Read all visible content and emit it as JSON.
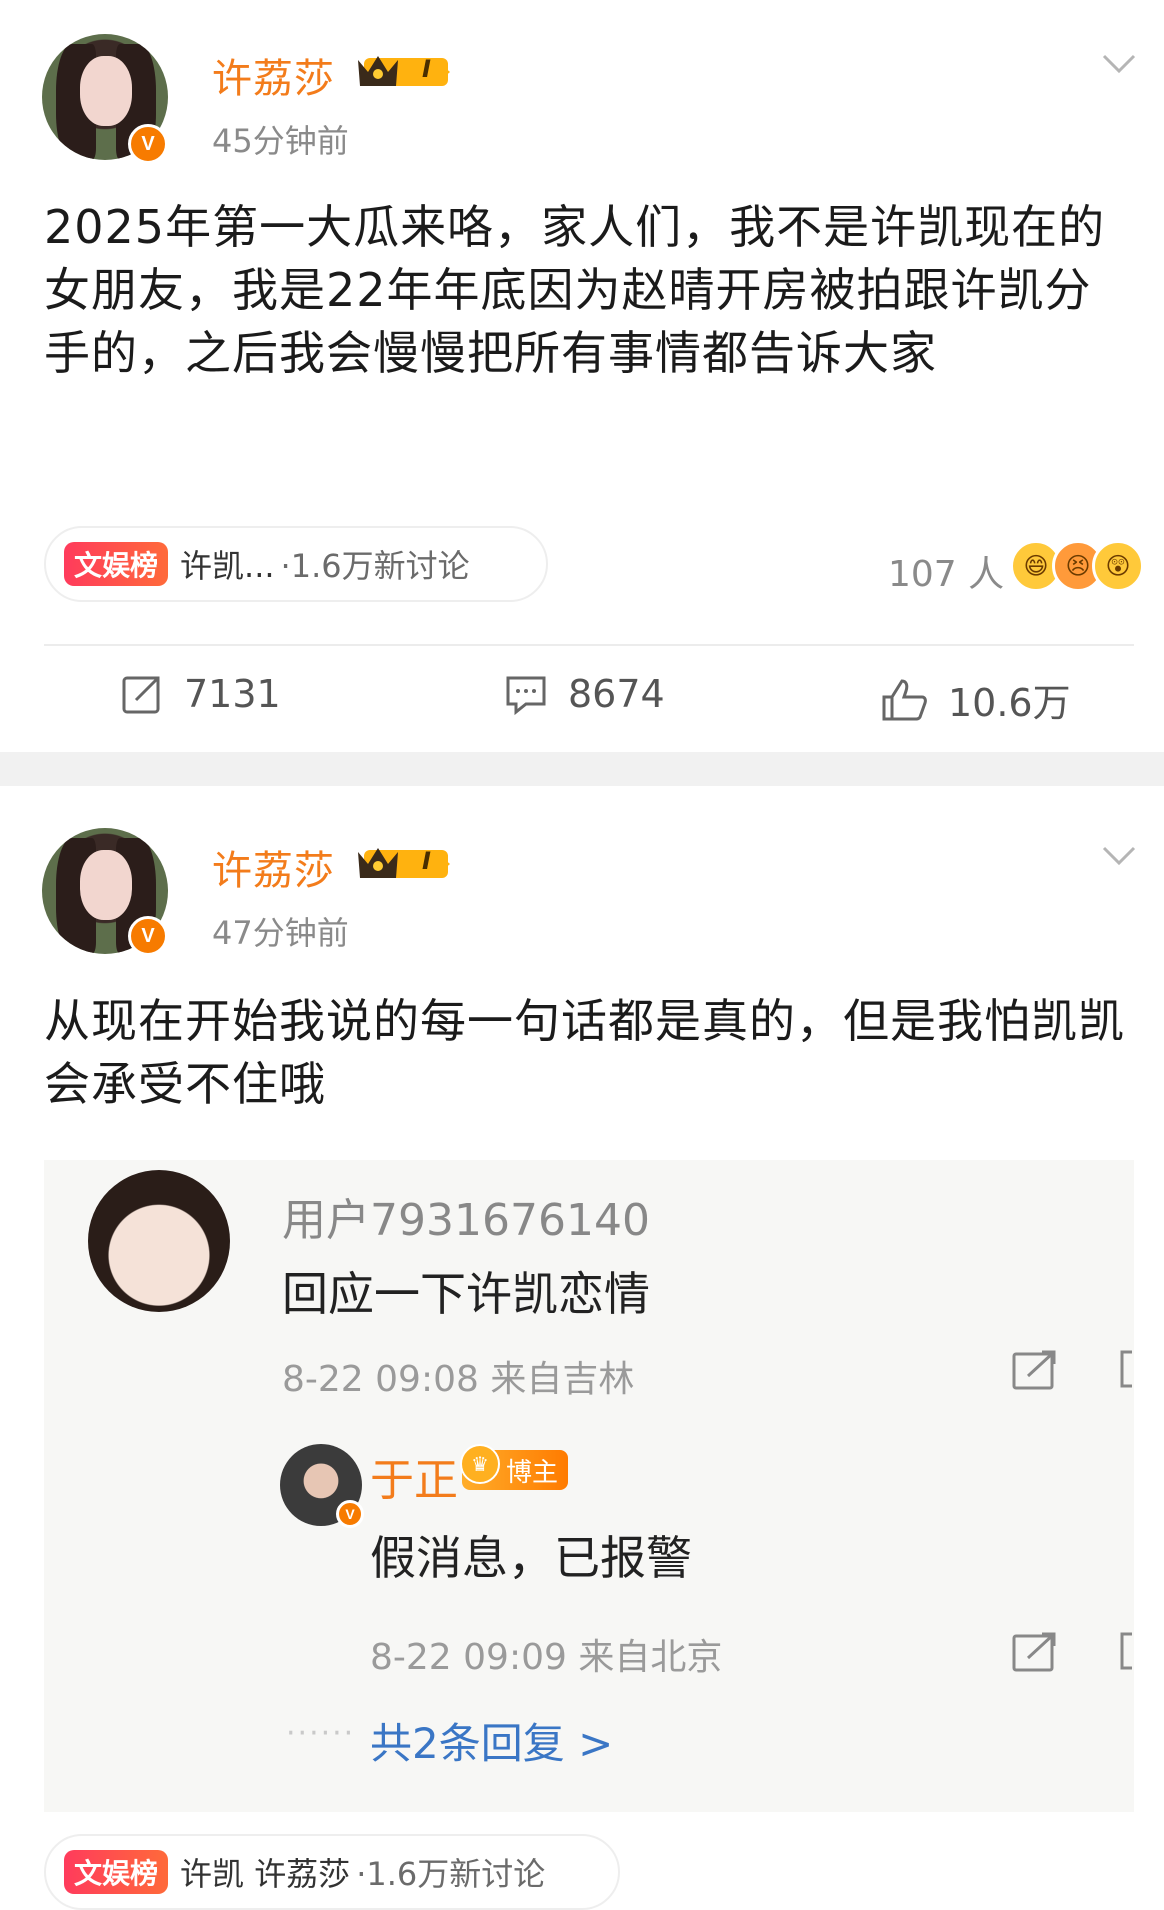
{
  "post1": {
    "username": "许荔莎",
    "level": "I",
    "time": "45分钟前",
    "text": "2025年第一大瓜来咯，家人们，我不是许凯现在的女朋友，我是22年年底因为赵晴开房被拍跟许凯分手的，之后我会慢慢把所有事情都告诉大家",
    "topic": {
      "tag": "文娱榜",
      "name": "许凯...",
      "count": "·1.6万新讨论"
    },
    "reactions": "107 人",
    "actions": {
      "repost": "7131",
      "comment": "8674",
      "like": "10.6万"
    }
  },
  "post2": {
    "username": "许荔莎",
    "level": "I",
    "time": "47分钟前",
    "text": "从现在开始我说的每一句话都是真的，但是我怕凯凯会承受不住哦",
    "quoted_comment": {
      "username": "用户7931676140",
      "text": "回应一下许凯恋情",
      "meta": "8-22 09:08 来自吉林",
      "reply": {
        "username": "于正",
        "badge": "博主",
        "text": "假消息，已报警",
        "meta": "8-22 09:09 来自北京"
      },
      "dots": "······",
      "more": "共2条回复 >"
    },
    "topic": {
      "tag": "文娱榜",
      "name": "许凯 许荔莎",
      "count": "·1.6万新讨论"
    }
  },
  "colors": {
    "username": "#f37c1b",
    "link": "#3a76c5",
    "topic_tag": "#ff3b5c",
    "verified": "#f77b00"
  }
}
